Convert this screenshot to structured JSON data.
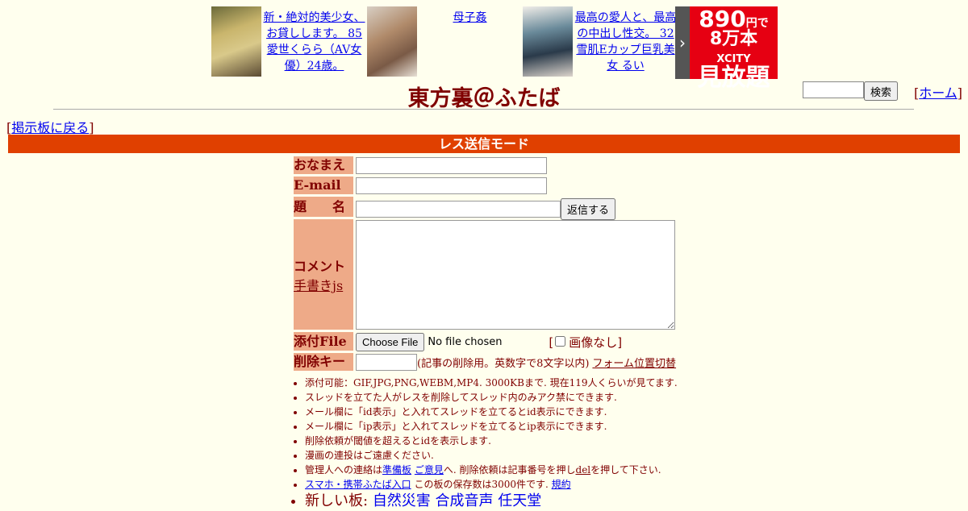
{
  "ads": [
    {
      "text": "新・絶対的美少女、お貸しします。 85 愛世くらら（AV女優）24歳。"
    },
    {
      "text": "母子姦"
    },
    {
      "text": "最高の愛人と、最高の中出し性交。 32 雪肌Eカップ巨乳美女 るい"
    }
  ],
  "banner": {
    "arrow": "›",
    "price": "890",
    "price_unit": "円で",
    "count": "8万本",
    "brand": "XCITY",
    "tagline": "見放題"
  },
  "site_title": "東方裏＠ふたば",
  "search": {
    "button": "検索",
    "value": ""
  },
  "home_link": "ホーム",
  "back_link": "掲示板に戻る",
  "mode_bar": "レス送信モード",
  "form": {
    "name_label": "おなまえ",
    "email_label": "E-mail",
    "subject_label": "題　　名",
    "submit_label": "返信する",
    "comment_label": "コメント",
    "handwrite_link": "手書きjs",
    "file_label": "添付File",
    "choose_file_button": "Choose File",
    "no_file_text": "No file chosen",
    "no_image_label": "画像なし",
    "delkey_label": "削除キー",
    "delkey_note": "(記事の削除用。英数字で8文字以内)",
    "form_toggle_link": "フォーム位置切替"
  },
  "notes": {
    "n1": "添付可能：GIF,JPG,PNG,WEBM,MP4. 3000KBまで. 現在119人くらいが見てます.",
    "n2": "スレッドを立てた人がレスを削除してスレッド内のみアク禁にできます.",
    "n3": "メール欄に「id表示」と入れてスレッドを立てるとid表示にできます.",
    "n4": "メール欄に「ip表示」と入れてスレッドを立てるとip表示にできます.",
    "n5": "削除依頼が閾値を超えるとidを表示します.",
    "n6": "漫画の連投はご遠慮ください.",
    "n7_a": "管理人への連絡は",
    "n7_link1": "準備板",
    "n7_link2": "ご意見",
    "n7_b": "へ. 削除依頼は記事番号を押し",
    "n7_link3": "del",
    "n7_c": "を押して下さい.",
    "n8_link": "スマホ・携帯ふたば入口",
    "n8_text": "この板の保存数は3000件です.",
    "n8_link2": "規約",
    "n9_label": "新しい板:",
    "n9_boards": [
      "自然災害",
      "合成音声",
      "任天堂"
    ]
  }
}
